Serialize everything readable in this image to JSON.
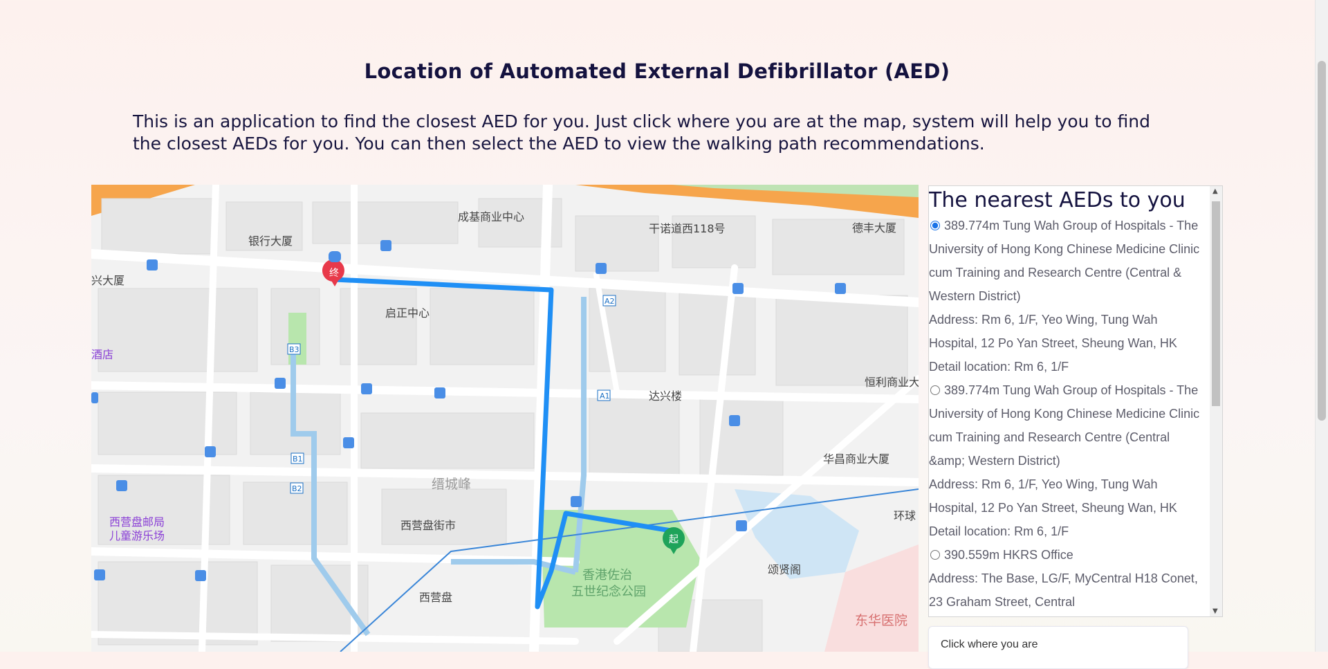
{
  "page": {
    "title": "Location of Automated External Defibrillator (AED)",
    "description": "This is an application to find the closest AED for you. Just click where you are at the map, system will help you to find the closest AEDs for you. You can then select the AED to view the walking path recommendations."
  },
  "map": {
    "labels": {
      "l1": "成基商业中心",
      "l2": "干诺道西118号",
      "l3": "德丰大厦",
      "l4": "银行大厦",
      "l5": "兴大厦",
      "l6": "启正中心",
      "l7": "酒店",
      "l8": "达兴楼",
      "l9": "恒利商业大",
      "l10": "华昌商业大厦",
      "l11": "缙城峰",
      "l12": "西营盘邮局",
      "l13": "儿童游乐场",
      "l14": "西营盘街市",
      "l15": "环球",
      "l16": "颂贤阁",
      "l17": "香港佐治",
      "l18": "五世纪念公园",
      "l19": "西营盘",
      "l20": "东华医院"
    },
    "exits": {
      "a1": "A1",
      "a2": "A2",
      "b1": "B1",
      "b2": "B2",
      "b3": "B3"
    },
    "markers": {
      "start": "起",
      "end": "终"
    },
    "colors": {
      "route": "#1f8ff5",
      "park": "#b8e6ad",
      "water": "#cfe5f5",
      "highway": "#f6a54c",
      "start": "#1ea35a",
      "end": "#e8394a"
    }
  },
  "aed_panel": {
    "heading": "The nearest AEDs to you",
    "items": [
      {
        "selected": true,
        "title": "389.774m Tung Wah Group of Hospitals - The University of Hong Kong Chinese Medicine Clinic cum Training and Research Centre (Central & Western District)",
        "address": "Address: Rm 6, 1/F, Yeo Wing, Tung Wah Hospital, 12 Po Yan Street, Sheung Wan, HK",
        "detail": "Detail location: Rm 6, 1/F"
      },
      {
        "selected": false,
        "title": "389.774m Tung Wah Group of Hospitals - The University of Hong Kong Chinese Medicine Clinic cum Training and Research Centre (Central &amp; Western District)",
        "address": "Address: Rm 6, 1/F, Yeo Wing, Tung Wah Hospital, 12 Po Yan Street, Sheung Wan, HK",
        "detail": "Detail location: Rm 6, 1/F"
      },
      {
        "selected": false,
        "title": "390.559m HKRS Office",
        "address": "Address: The Base, LG/F, MyCentral H18 Conet, 23 Graham Street, Central"
      }
    ]
  },
  "click_box": {
    "label": "Click where you are"
  }
}
